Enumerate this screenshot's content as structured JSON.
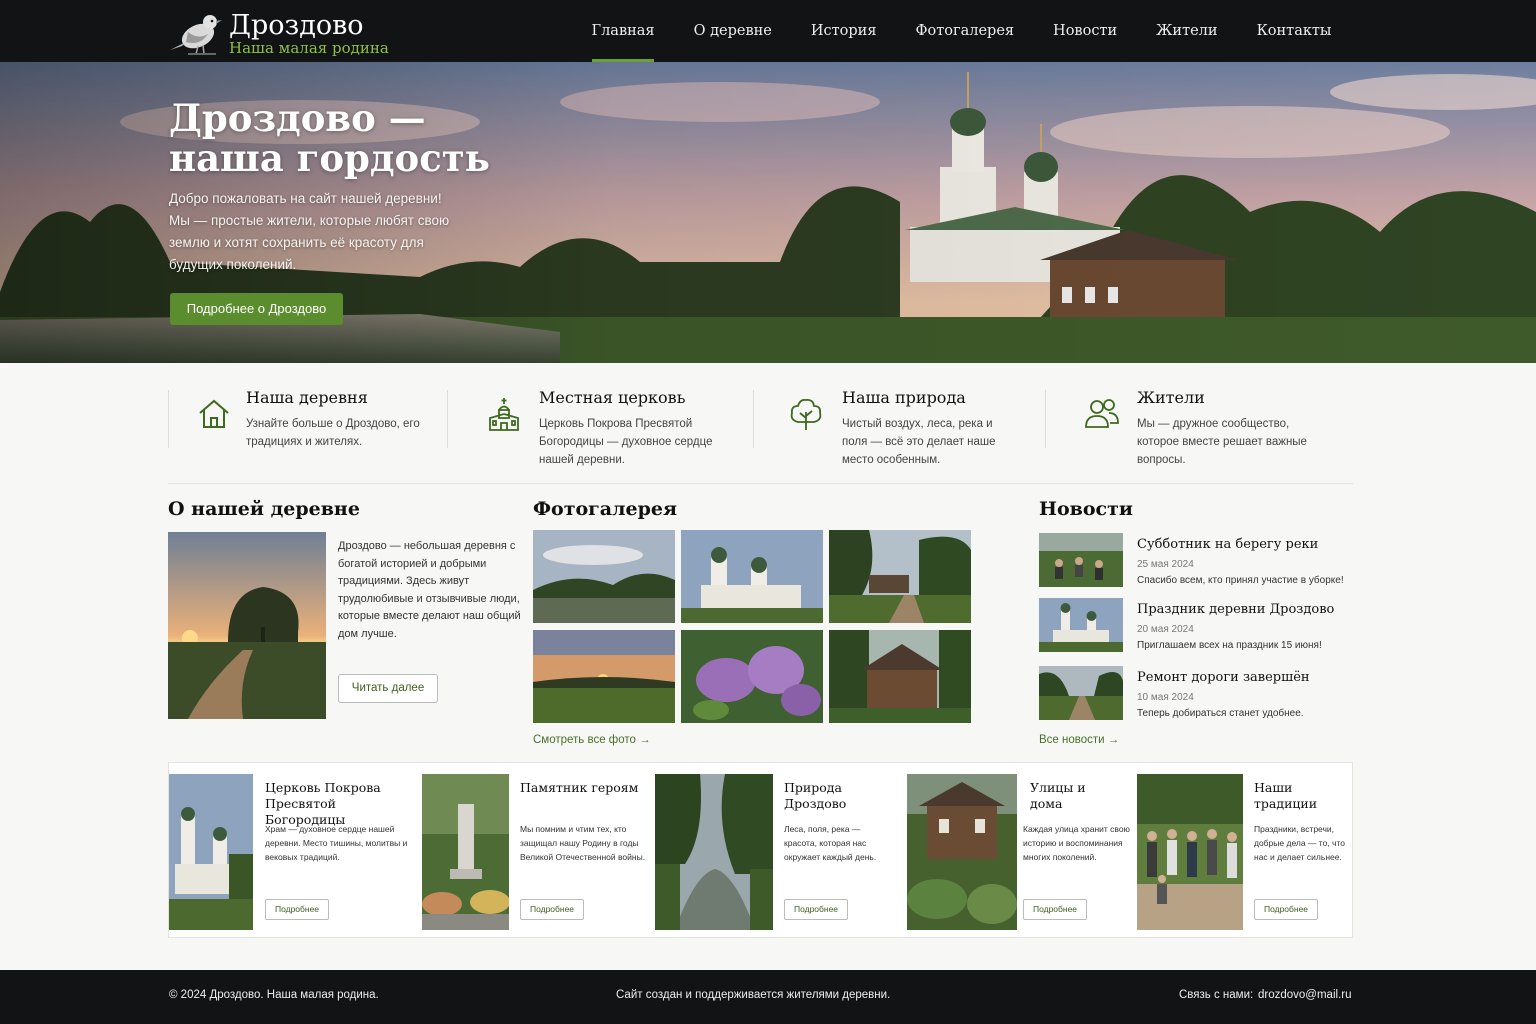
{
  "brand": {
    "title": "Дроздово",
    "subtitle": "Наша малая родина"
  },
  "nav": [
    {
      "label": "Главная",
      "active": true
    },
    {
      "label": "О деревне"
    },
    {
      "label": "История"
    },
    {
      "label": "Фотогалерея"
    },
    {
      "label": "Новости"
    },
    {
      "label": "Жители"
    },
    {
      "label": "Контакты"
    }
  ],
  "hero": {
    "title_line1": "Дроздово —",
    "title_line2": "наша гордость",
    "text": "Добро пожаловать на сайт нашей деревни! Мы — простые жители, которые любят свою землю и хотят сохранить её красоту для будущих поколений.",
    "button": "Подробнее о Дроздово"
  },
  "features": [
    {
      "icon": "house-icon",
      "title": "Наша деревня",
      "text": "Узнайте больше о Дроздово, его традициях и жителях."
    },
    {
      "icon": "church-icon",
      "title": "Местная церковь",
      "text": "Церковь Покрова Пресвятой Богородицы — духовное сердце нашей деревни."
    },
    {
      "icon": "tree-icon",
      "title": "Наша природа",
      "text": "Чистый воздух, леса, река и поля — всё это делает наше место особенным."
    },
    {
      "icon": "people-icon",
      "title": "Жители",
      "text": "Мы — дружное сообщество, которое вместе решает важные вопросы."
    }
  ],
  "about": {
    "title": "О нашей деревне",
    "text": "Дроздово — небольшая деревня с богатой историей и добрыми традициями. Здесь живут трудолюбивые и отзывчивые люди, которые вместе делают наш общий дом лучше.",
    "button": "Читать далее"
  },
  "gallery": {
    "title": "Фотогалерея",
    "link": "Смотреть все фото →"
  },
  "news": {
    "title": "Новости",
    "items": [
      {
        "title": "Субботник на берегу реки",
        "date": "25 мая 2024",
        "text": "Спасибо всем, кто принял участие в уборке!"
      },
      {
        "title": "Праздник деревни Дроздово",
        "date": "20 мая 2024",
        "text": "Приглашаем всех на праздник 15 июня!"
      },
      {
        "title": "Ремонт дороги завершён",
        "date": "10 мая 2024",
        "text": "Теперь добираться станет удобнее."
      }
    ],
    "link": "Все новости →"
  },
  "cards": [
    {
      "title": "Церковь Покрова Пресвятой Богородицы",
      "text": "Храм — духовное сердце нашей деревни. Место тишины, молитвы и вековых традиций.",
      "button": "Подробнее"
    },
    {
      "title": "Памятник героям",
      "text": "Мы помним и чтим тех, кто защищал нашу Родину в годы Великой Отечественной войны.",
      "button": "Подробнее"
    },
    {
      "title": "Природа Дроздово",
      "text": "Леса, поля, река — красота, которая нас окружает каждый день.",
      "button": "Подробнее"
    },
    {
      "title": "Улицы и дома",
      "text": "Каждая улица хранит свою историю и воспоминания многих поколений.",
      "button": "Подробнее"
    },
    {
      "title": "Наши традиции",
      "text": "Праздники, встречи, добрые дела — то, что нас и делает сильнее.",
      "button": "Подробнее"
    }
  ],
  "footer": {
    "copyright": "© 2024 Дроздово. Наша малая родина.",
    "made_by": "Сайт создан и поддерживается жителями деревни.",
    "contact_label": "Связь с нами:",
    "email": "drozdovo@mail.ru"
  },
  "colors": {
    "accent": "#5b8d2e",
    "dark": "#121315",
    "logo_sub": "#8fbf48"
  }
}
